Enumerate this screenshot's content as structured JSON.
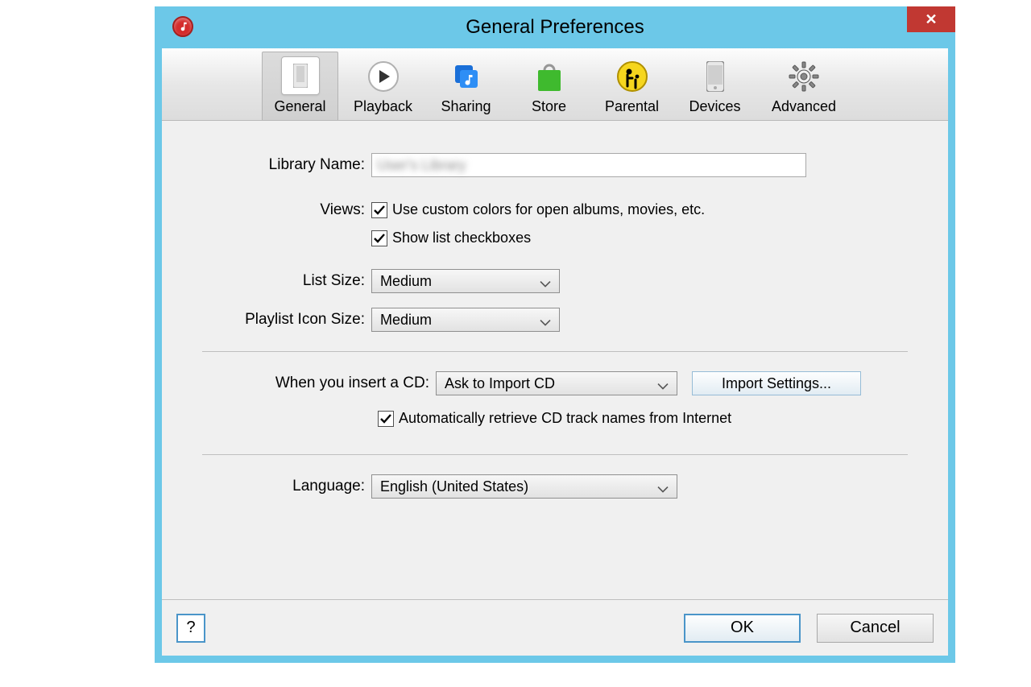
{
  "window": {
    "title": "General Preferences"
  },
  "tabs": {
    "general": "General",
    "playback": "Playback",
    "sharing": "Sharing",
    "store": "Store",
    "parental": "Parental",
    "devices": "Devices",
    "advanced": "Advanced"
  },
  "form": {
    "library_name_label": "Library Name:",
    "library_name_value": "User's Library",
    "views_label": "Views:",
    "views_custom_colors": "Use custom colors for open albums, movies, etc.",
    "views_show_checkboxes": "Show list checkboxes",
    "list_size_label": "List Size:",
    "list_size_value": "Medium",
    "playlist_icon_label": "Playlist Icon Size:",
    "playlist_icon_value": "Medium",
    "insert_cd_label": "When you insert a CD:",
    "insert_cd_value": "Ask to Import CD",
    "import_settings_btn": "Import Settings...",
    "auto_retrieve_cd": "Automatically retrieve CD track names from Internet",
    "language_label": "Language:",
    "language_value": "English (United States)"
  },
  "footer": {
    "help": "?",
    "ok": "OK",
    "cancel": "Cancel"
  }
}
